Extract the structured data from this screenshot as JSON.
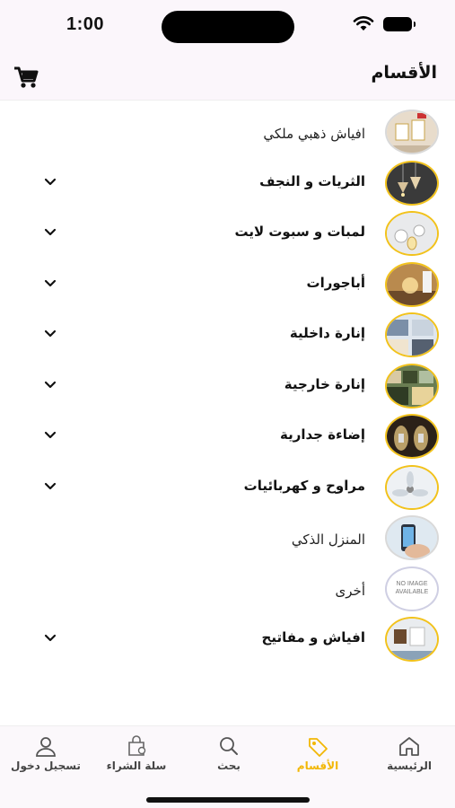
{
  "status_bar": {
    "time": "1:00"
  },
  "header": {
    "title": "الأقسام",
    "cart_icon": "cart-icon"
  },
  "categories": [
    {
      "label": "افياش ذهبي ملكي",
      "expandable": false,
      "image": "gold-switches"
    },
    {
      "label": "الثريات و النجف",
      "expandable": true,
      "image": "chandeliers"
    },
    {
      "label": "لمبات و سبوت لايت",
      "expandable": true,
      "image": "bulbs"
    },
    {
      "label": "أباجورات",
      "expandable": true,
      "image": "lamps"
    },
    {
      "label": "إنارة داخلية",
      "expandable": true,
      "image": "indoor"
    },
    {
      "label": "إنارة خارجية",
      "expandable": true,
      "image": "outdoor"
    },
    {
      "label": "إضاءة جدارية",
      "expandable": true,
      "image": "wall"
    },
    {
      "label": "مراوح و كهربائيات",
      "expandable": true,
      "image": "fans"
    },
    {
      "label": "المنزل الذكي",
      "expandable": false,
      "image": "smart-home"
    },
    {
      "label": "أخرى",
      "expandable": false,
      "image": "no-image"
    },
    {
      "label": "افياش و مفاتيح",
      "expandable": true,
      "image": "sockets"
    }
  ],
  "no_image": {
    "line1": "NO IMAGE",
    "line2": "AVAILABLE"
  },
  "tabs": [
    {
      "label": "الرئيسية",
      "icon": "home-icon"
    },
    {
      "label": "الأقسام",
      "icon": "tag-icon",
      "active": true
    },
    {
      "label": "بحث",
      "icon": "search-icon"
    },
    {
      "label": "سلة الشراء",
      "icon": "bag-icon"
    },
    {
      "label": "تسجيل دخول",
      "icon": "user-icon"
    }
  ],
  "colors": {
    "accent": "#f2c21b",
    "active_tab": "#f2b705",
    "header_bg": "#fbf6fb"
  }
}
